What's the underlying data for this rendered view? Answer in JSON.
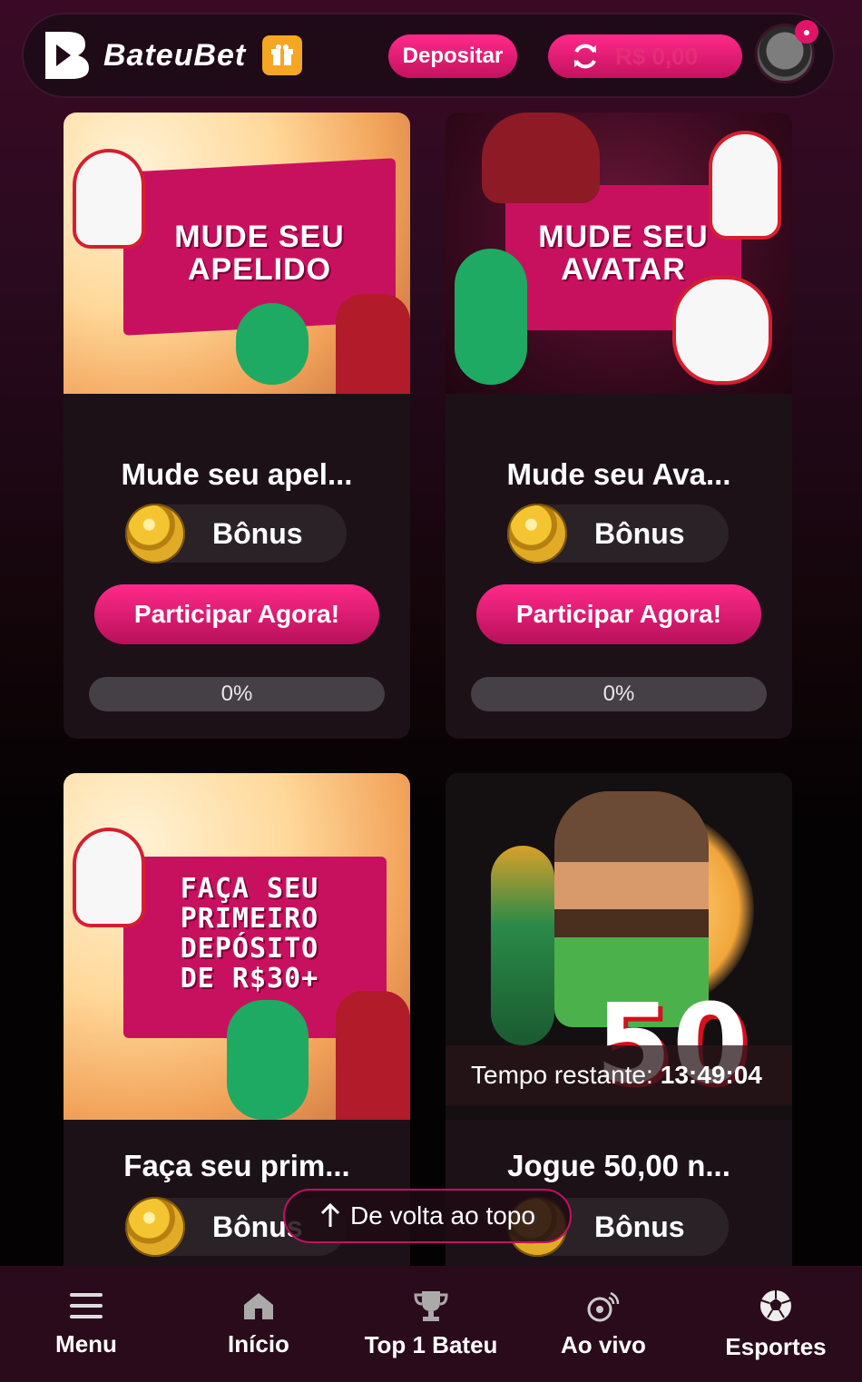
{
  "header": {
    "logo_text": "BateuBet",
    "deposit_label": "Depositar",
    "balance": "R$ 0,00"
  },
  "cards": [
    {
      "banner_lines": [
        "MUDE SEU",
        "APELIDO"
      ],
      "title": "Mude seu apel...",
      "bonus_label": "Bônus",
      "button_label": "Participar Agora!",
      "progress": "0%"
    },
    {
      "banner_lines": [
        "MUDE SEU",
        "AVATAR"
      ],
      "title": "Mude seu Ava...",
      "bonus_label": "Bônus",
      "button_label": "Participar Agora!",
      "progress": "0%"
    },
    {
      "banner_lines": [
        "FAÇA SEU",
        "PRIMEIRO",
        "DEPÓSITO",
        "DE R$30+"
      ],
      "title": "Faça seu prim...",
      "bonus_label": "Bônus"
    },
    {
      "banner_number": "50",
      "timer_label": "Tempo restante:",
      "timer_value": "13:49:04",
      "title": "Jogue 50,00 n...",
      "bonus_label": "Bônus"
    }
  ],
  "back_to_top": "De volta ao topo",
  "nav": [
    {
      "label": "Menu",
      "icon": "menu-icon"
    },
    {
      "label": "Início",
      "icon": "home-icon"
    },
    {
      "label": "Top 1 Bateu",
      "icon": "trophy-icon"
    },
    {
      "label": "Ao vivo",
      "icon": "live-ball-icon"
    },
    {
      "label": "Esportes",
      "icon": "soccer-ball-icon"
    }
  ],
  "colors": {
    "accent": "#e3136a",
    "gift": "#f5a623",
    "card_bg": "#1c1117",
    "nav_bg": "#2a0b1b"
  }
}
